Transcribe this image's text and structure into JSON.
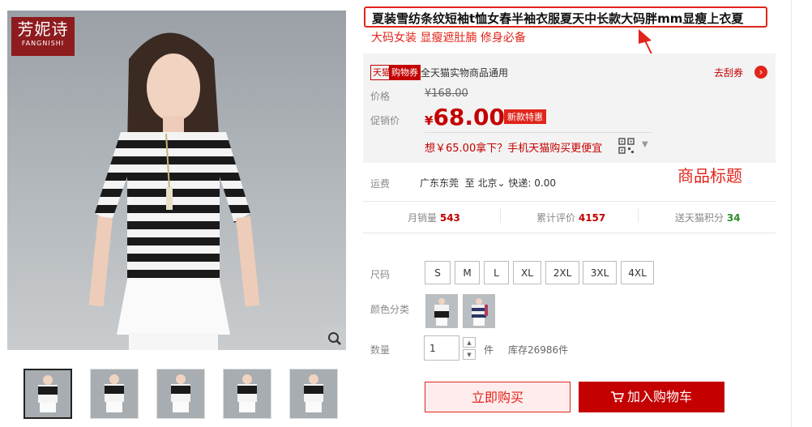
{
  "brand": {
    "name_cn": "芳妮诗",
    "name_en": "FANGNISHI"
  },
  "product": {
    "title": "夏装雪纺条纹短袖t恤女春半袖衣服夏天中长款大码胖mm显瘦上衣夏",
    "subtitle": "大码女装 显瘦遮肚腩 修身必备"
  },
  "coupon": {
    "badge_tmall": "天猫",
    "badge_voucher": "购物券",
    "text": "全天猫实物商品通用",
    "link": "去刮券"
  },
  "price": {
    "original_label": "价格",
    "original": "¥168.00",
    "promo_label": "促销价",
    "currency": "¥",
    "promo": "68.00",
    "promo_tag": "新款特惠",
    "mobile_deal": "想￥65.00拿下？手机天猫购买更便宜"
  },
  "shipping": {
    "label": "运费",
    "origin": "广东东莞",
    "to": "至",
    "dest": "北京",
    "fee": "快递: 0.00"
  },
  "stats": {
    "monthly_sales_label": "月销量",
    "monthly_sales": "543",
    "reviews_label": "累计评价",
    "reviews": "4157",
    "points_label": "送天猫积分",
    "points": "34"
  },
  "annotation": "商品标题",
  "sku": {
    "size_label": "尺码",
    "sizes": [
      "S",
      "M",
      "L",
      "XL",
      "2XL",
      "3XL",
      "4XL"
    ],
    "color_label": "颜色分类",
    "qty_label": "数量",
    "qty": "1",
    "unit": "件",
    "stock": "库存26986件"
  },
  "actions": {
    "buy_now": "立即购买",
    "add_cart": "加入购物车"
  },
  "colors": {
    "accent": "#e1251b",
    "price_red": "#c40000"
  }
}
